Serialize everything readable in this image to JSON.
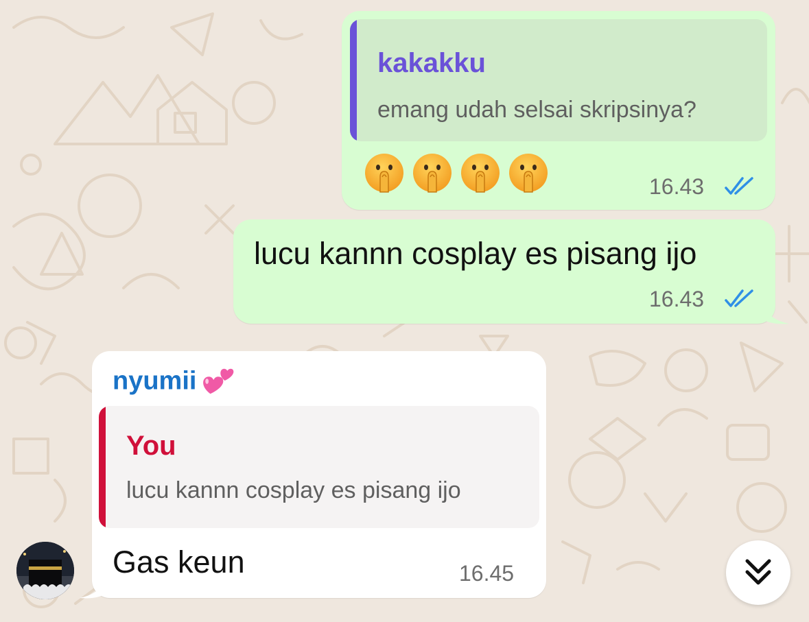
{
  "colors": {
    "background": "#efe7de",
    "outgoing_bubble": "#d8fdd2",
    "incoming_bubble": "#ffffff",
    "read_tick": "#2f8fe6",
    "quote1_accent": "#6a52d8",
    "quote2_accent": "#d0103a",
    "sender_name": "#1a73c7"
  },
  "messages": [
    {
      "direction": "outgoing",
      "quote": {
        "name": "kakakku",
        "text": "emang udah selsai skripsinya?"
      },
      "emojis": [
        "shushing-face",
        "shushing-face",
        "shushing-face",
        "shushing-face"
      ],
      "time": "16.43",
      "status": "read"
    },
    {
      "direction": "outgoing",
      "text": "lucu kannn cosplay es pisang ijo",
      "time": "16.43",
      "status": "read"
    },
    {
      "direction": "incoming",
      "sender": "nyumii",
      "sender_emoji": "two-hearts",
      "quote": {
        "name": "You",
        "text": "lucu kannn cosplay es pisang ijo"
      },
      "text": "Gas keun",
      "time": "16.45"
    }
  ],
  "scroll_button_icon": "chevron-double-down-icon"
}
